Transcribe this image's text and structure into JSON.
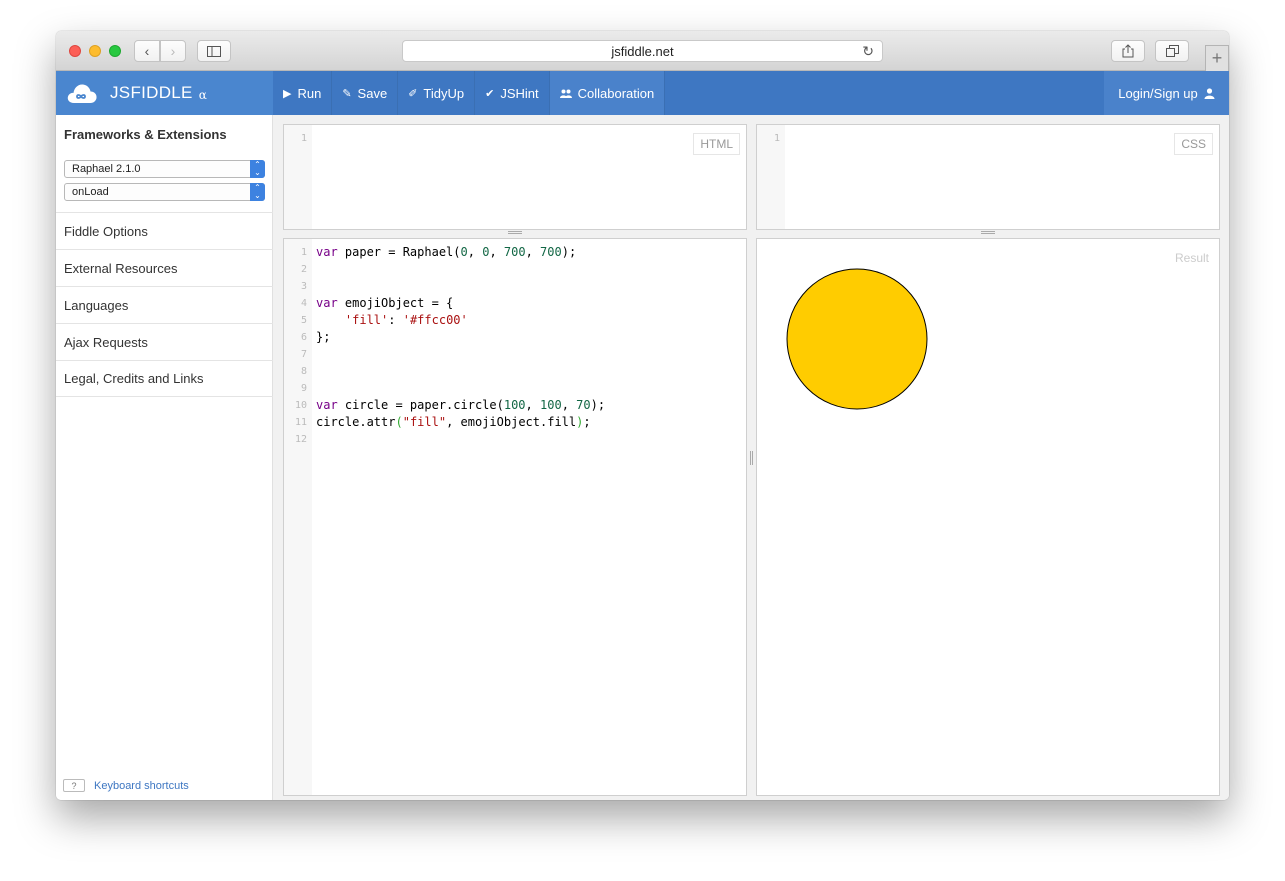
{
  "browser": {
    "url": "jsfiddle.net"
  },
  "header": {
    "logo": "JSFIDDLE",
    "logo_suffix": "α",
    "actions": [
      {
        "label": "Run",
        "icon": "play-icon"
      },
      {
        "label": "Save",
        "icon": "pencil-icon"
      },
      {
        "label": "TidyUp",
        "icon": "broom-icon"
      },
      {
        "label": "JSHint",
        "icon": "check-icon"
      },
      {
        "label": "Collaboration",
        "icon": "people-icon"
      }
    ],
    "login": "Login/Sign up"
  },
  "sidebar": {
    "title": "Frameworks & Extensions",
    "framework_value": "Raphael 2.1.0",
    "load_value": "onLoad",
    "items": [
      {
        "label": "Fiddle Options"
      },
      {
        "label": "External Resources"
      },
      {
        "label": "Languages"
      },
      {
        "label": "Ajax Requests"
      },
      {
        "label": "Legal, Credits and Links"
      }
    ],
    "shortcut_key": "?",
    "shortcut_label": "Keyboard shortcuts"
  },
  "panes": {
    "html_label": "HTML",
    "css_label": "CSS",
    "result_label": "Result"
  },
  "editor_js": {
    "line_numbers": [
      "1",
      "2",
      "3",
      "4",
      "5",
      "6",
      "7",
      "8",
      "9",
      "10",
      "11",
      "12"
    ],
    "lines": [
      "var paper = Raphael(0, 0, 700, 700);",
      "",
      "",
      "var emojiObject = {",
      "    'fill': '#ffcc00'",
      "};",
      "",
      "",
      "",
      "var circle = paper.circle(100, 100, 70);",
      "circle.attr(\"fill\", emojiObject.fill);",
      ""
    ]
  },
  "result": {
    "circle_fill": "#ffcc00",
    "circle_stroke": "#000000"
  },
  "colors": {
    "header_blue": "#3e77c2",
    "select_blue": "#3d82e0"
  }
}
